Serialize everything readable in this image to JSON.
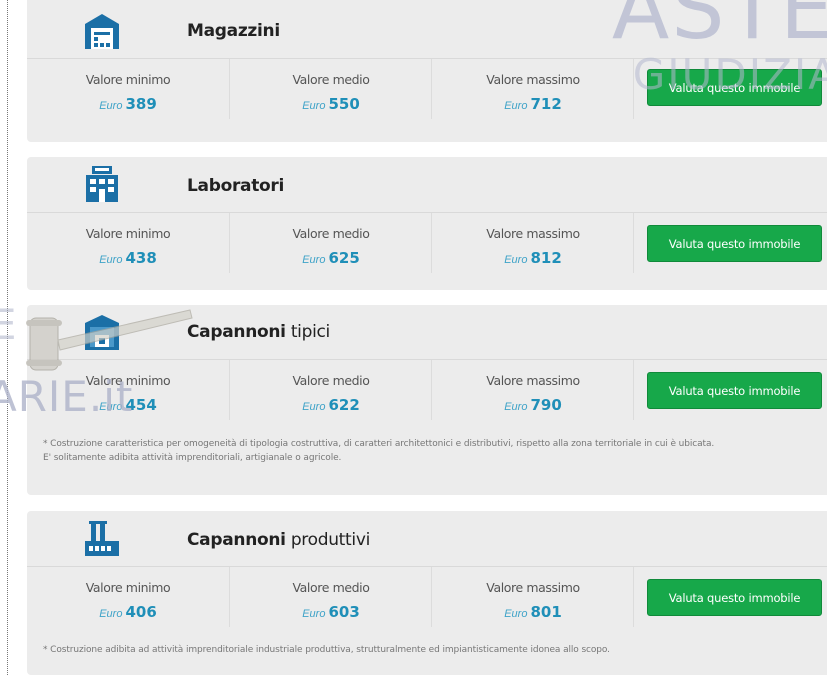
{
  "watermark": {
    "line1": "ASTE",
    "line2": "GIUDIZIA",
    "line3": "ARIE.it",
    "fragment": "E"
  },
  "cards": [
    {
      "title_bold": "Magazzini",
      "title_light": "",
      "icon": "warehouse-icon",
      "labels": [
        "Valore minimo",
        "Valore medio",
        "Valore massimo"
      ],
      "currency": "Euro",
      "values": [
        "389",
        "550",
        "712"
      ],
      "button": "Valuta questo immobile",
      "notes": []
    },
    {
      "title_bold": "Laboratori",
      "title_light": "",
      "icon": "laboratory-icon",
      "labels": [
        "Valore minimo",
        "Valore medio",
        "Valore massimo"
      ],
      "currency": "Euro",
      "values": [
        "438",
        "625",
        "812"
      ],
      "button": "Valuta questo immobile",
      "notes": []
    },
    {
      "title_bold": "Capannoni",
      "title_light": "tipici",
      "icon": "shed-icon",
      "labels": [
        "Valore minimo",
        "Valore medio",
        "Valore massimo"
      ],
      "currency": "Euro",
      "values": [
        "454",
        "622",
        "790"
      ],
      "button": "Valuta questo immobile",
      "notes": [
        "* Costruzione caratteristica per omogeneità di tipologia costruttiva, di caratteri architettonici e distributivi, rispetto alla zona territoriale in cui è ubicata.",
        "E' solitamente adibita attività imprenditoriali, artigianale o agricole."
      ]
    },
    {
      "title_bold": "Capannoni",
      "title_light": "produttivi",
      "icon": "factory-icon",
      "labels": [
        "Valore minimo",
        "Valore medio",
        "Valore massimo"
      ],
      "currency": "Euro",
      "values": [
        "406",
        "603",
        "801"
      ],
      "button": "Valuta questo immobile",
      "notes": [
        "* Costruzione adibita ad attività imprenditoriale industriale produttiva, strutturalmente ed impiantisticamente idonea allo scopo."
      ]
    }
  ],
  "colors": {
    "accent_blue": "#1f8fb8",
    "button_green": "#17a84a",
    "icon_blue": "#1b6fa6",
    "card_bg": "#ececec"
  }
}
